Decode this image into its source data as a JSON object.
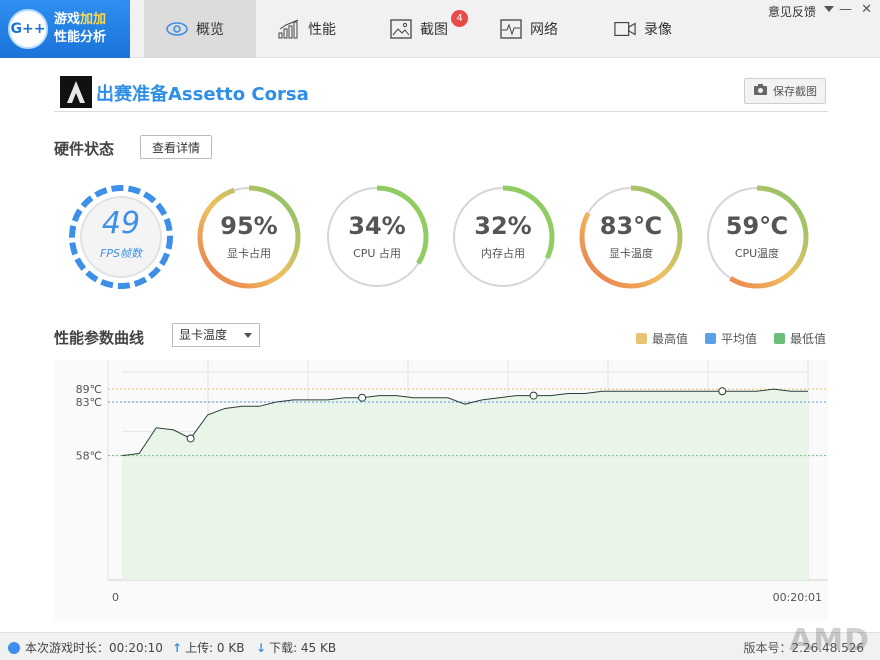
{
  "app": {
    "logo_mark": "G++",
    "logo_line1a": "游戏",
    "logo_line1b": "加加",
    "logo_line2": "性能分析"
  },
  "tabs": [
    {
      "label": "概览",
      "icon": "eye-icon",
      "active": true
    },
    {
      "label": "性能",
      "icon": "bar-chart-icon"
    },
    {
      "label": "截图",
      "icon": "picture-icon",
      "badge": "4"
    },
    {
      "label": "网络",
      "icon": "pulse-icon"
    },
    {
      "label": "录像",
      "icon": "video-icon"
    }
  ],
  "window": {
    "feedback": "意见反馈",
    "minimize": "—",
    "close": "✕"
  },
  "game": {
    "title": "出赛准备Assetto Corsa",
    "save_screenshot": "保存截图"
  },
  "hardware": {
    "title": "硬件状态",
    "detail_button": "查看详情"
  },
  "gauges": [
    {
      "value": "49",
      "label": "FPS帧数",
      "percent": 1.0
    },
    {
      "value": "95%",
      "label": "显卡占用",
      "percent": 0.95
    },
    {
      "value": "34%",
      "label": "CPU 占用",
      "percent": 0.34
    },
    {
      "value": "32%",
      "label": "内存占用",
      "percent": 0.32
    },
    {
      "value": "83℃",
      "label": "显卡温度",
      "percent": 0.83
    },
    {
      "value": "59℃",
      "label": "CPU温度",
      "percent": 0.59
    }
  ],
  "curve": {
    "title": "性能参数曲线",
    "selected": "显卡温度",
    "legend": [
      {
        "label": "最高值",
        "color": "#e8c470"
      },
      {
        "label": "平均值",
        "color": "#5a9fe8"
      },
      {
        "label": "最低值",
        "color": "#6cbf7a"
      }
    ]
  },
  "chart_data": {
    "type": "area",
    "x_start_label": "0",
    "x_end_label": "00:20:01",
    "y_ticks": [
      "89℃",
      "83℃",
      "58℃"
    ],
    "max": 89,
    "avg": 83,
    "min": 58,
    "ylim": [
      0,
      97
    ],
    "x": [
      0,
      1,
      2,
      3,
      4,
      5,
      6,
      7,
      8,
      9,
      10,
      11,
      12,
      13,
      14,
      15,
      16,
      17,
      18,
      19,
      20,
      21,
      22,
      23,
      24,
      25,
      26,
      27,
      28,
      29,
      30,
      31,
      32,
      33,
      34,
      35,
      36,
      37,
      38,
      39,
      40
    ],
    "values": [
      58,
      59,
      71,
      70,
      66,
      77,
      80,
      81,
      81,
      83,
      84,
      84,
      84,
      85,
      85,
      86,
      86,
      85,
      85,
      85,
      82,
      84,
      85,
      86,
      86,
      86,
      87,
      87,
      88,
      88,
      88,
      88,
      88,
      88,
      88,
      88,
      88,
      88,
      89,
      88,
      88
    ],
    "markers": [
      4,
      14,
      24,
      35
    ],
    "grid": true
  },
  "status": {
    "duration": "本次游戏时长：00:20:10",
    "upload": "上传: 0 KB",
    "download": "下载: 45 KB",
    "brand": "AMD",
    "version": "版本号：2.26.48.526"
  }
}
